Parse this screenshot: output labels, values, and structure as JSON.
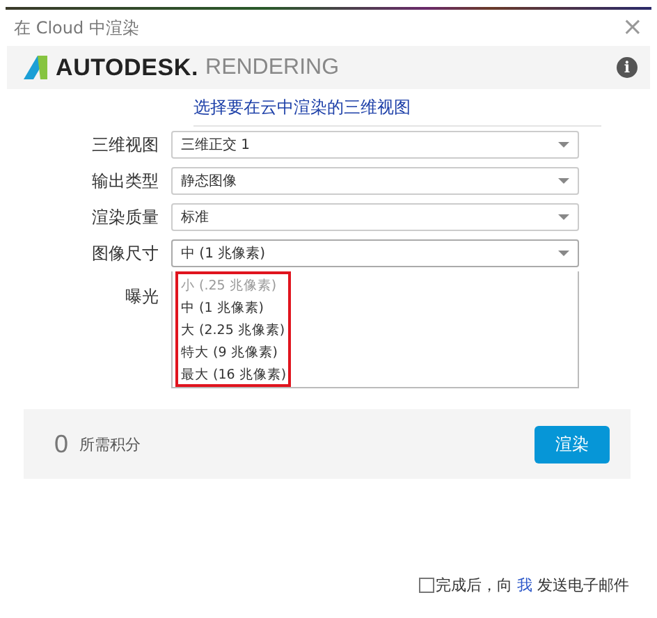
{
  "window": {
    "title": "在 Cloud 中渲染",
    "close": "×"
  },
  "header": {
    "brand": "AUTODESK.",
    "product": "RENDERING",
    "info": "i"
  },
  "subtitle": "选择要在云中渲染的三维视图",
  "fields": [
    {
      "label": "三维视图",
      "value": "三维正交 1",
      "expanded": false
    },
    {
      "label": "输出类型",
      "value": "静态图像",
      "expanded": false
    },
    {
      "label": "渲染质量",
      "value": "标准",
      "expanded": false
    },
    {
      "label": "图像尺寸",
      "value": "中 (1 兆像素)",
      "expanded": true
    }
  ],
  "exposure_label": "曝光",
  "dropdown_options": [
    {
      "label": "小 (.25 兆像素)",
      "disabled": true
    },
    {
      "label": "中 (1 兆像素)",
      "disabled": false
    },
    {
      "label": "大 (2.25 兆像素)",
      "disabled": false
    },
    {
      "label": "特大 (9 兆像素)",
      "disabled": false
    },
    {
      "label": "最大 (16 兆像素)",
      "disabled": false
    }
  ],
  "credits": {
    "value": "0",
    "label": "所需积分"
  },
  "render_button": "渲染",
  "email": {
    "checked": false,
    "before": "完成后，向",
    "link": "我",
    "after": "发送电子邮件"
  }
}
